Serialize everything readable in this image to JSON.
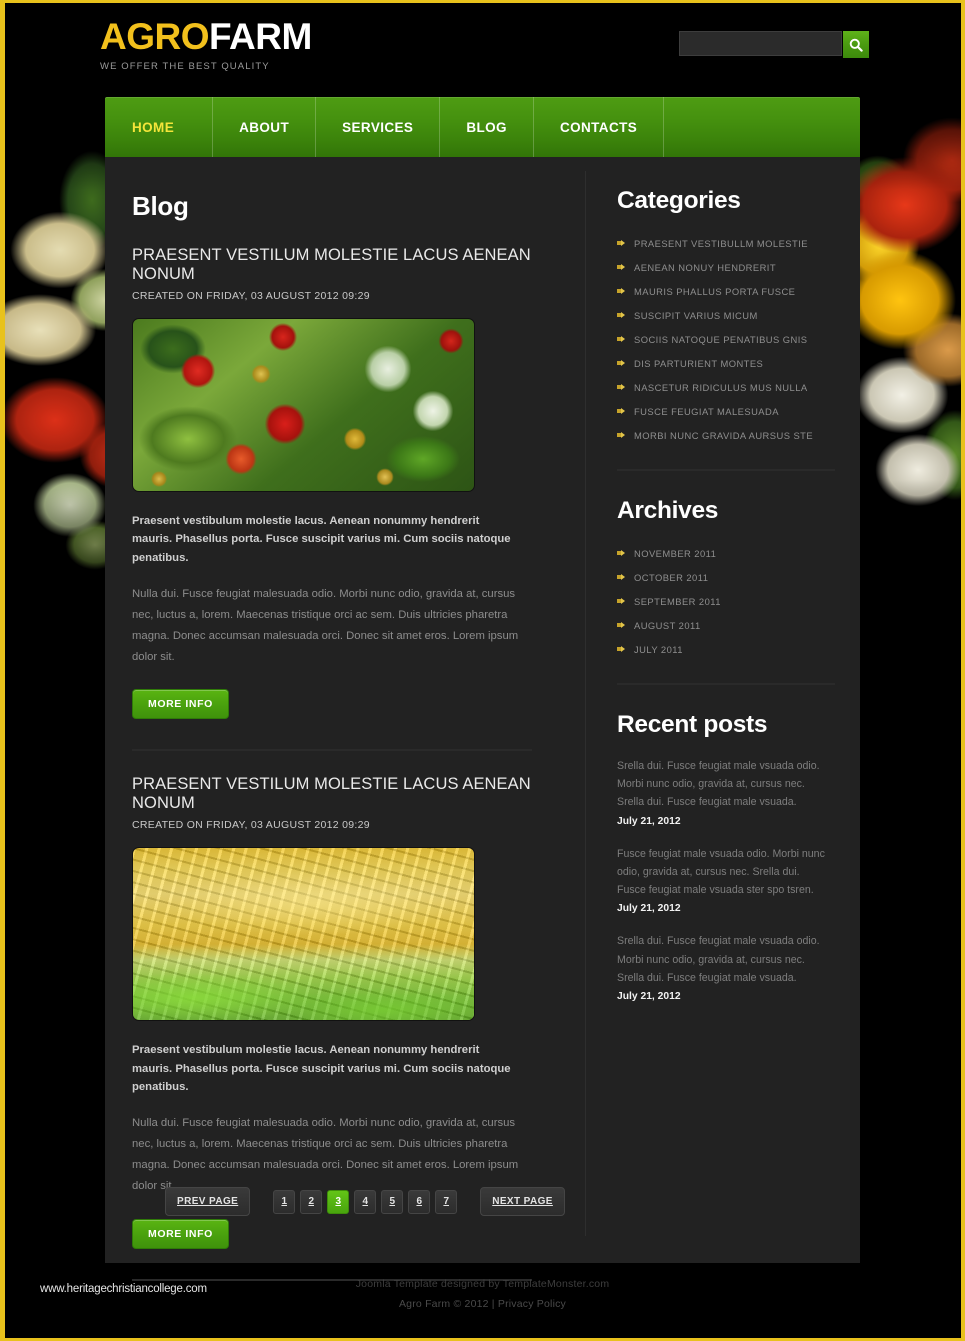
{
  "site": {
    "logo_primary": "AGRO",
    "logo_secondary": "FARM",
    "tagline": "WE OFFER THE BEST QUALITY"
  },
  "search": {
    "value": "",
    "placeholder": "",
    "icon": "search-icon"
  },
  "nav": {
    "items": [
      {
        "label": "HOME",
        "active": true
      },
      {
        "label": "ABOUT",
        "active": false
      },
      {
        "label": "SERVICES",
        "active": false
      },
      {
        "label": "BLOG",
        "active": false
      },
      {
        "label": "CONTACTS",
        "active": false
      }
    ]
  },
  "main": {
    "heading": "Blog",
    "posts": [
      {
        "title": "PRAESENT VESTILUM MOLESTIE LACUS AENEAN NONUM",
        "date": "CREATED ON FRIDAY, 03 AUGUST 2012 09:29",
        "image_alt": "raspberries-photo",
        "lead": "Praesent vestibulum molestie lacus. Aenean nonummy hendrerit mauris. Phasellus porta. Fusce suscipit varius mi. Cum sociis natoque penatibus.",
        "body": "Nulla dui. Fusce feugiat malesuada odio. Morbi nunc odio, gravida at, cursus nec, luctus a, lorem. Maecenas tristique orci ac sem. Duis ultricies pharetra magna. Donec accumsan malesuada orci. Donec sit amet eros. Lorem ipsum dolor sit.",
        "button_label": "MORE INFO"
      },
      {
        "title": "PRAESENT VESTILUM MOLESTIE LACUS AENEAN NONUM",
        "date": "CREATED ON FRIDAY, 03 AUGUST 2012 09:29",
        "image_alt": "corn-photo",
        "lead": "Praesent vestibulum molestie lacus. Aenean nonummy hendrerit mauris. Phasellus porta. Fusce suscipit varius mi. Cum sociis natoque penatibus.",
        "body": "Nulla dui. Fusce feugiat malesuada odio. Morbi nunc odio, gravida at, cursus nec, luctus a, lorem. Maecenas tristique orci ac sem. Duis ultricies pharetra magna. Donec accumsan malesuada orci. Donec sit amet eros. Lorem ipsum dolor sit.",
        "button_label": "MORE INFO"
      }
    ]
  },
  "pagination": {
    "prev_label": "PREV PAGE",
    "next_label": "NEXT PAGE",
    "pages": [
      "1",
      "2",
      "3",
      "4",
      "5",
      "6",
      "7"
    ],
    "current": "3"
  },
  "sidebar": {
    "categories": {
      "title": "Categories",
      "items": [
        "PRAESENT VESTIBULLM MOLESTIE",
        "AENEAN NONUY HENDRERIT",
        "MAURIS PHALLUS PORTA FUSCE",
        "SUSCIPIT VARIUS MICUM",
        "SOCIIS NATOQUE PENATIBUS GNIS",
        "DIS PARTURIENT MONTES",
        "NASCETUR RIDICULUS MUS NULLA",
        "FUSCE FEUGIAT MALESUADA",
        "MORBI NUNC GRAVIDA AURSUS STE"
      ]
    },
    "archives": {
      "title": "Archives",
      "items": [
        "NOVEMBER 2011",
        "OCTOBER 2011",
        "SEPTEMBER 2011",
        "AUGUST 2011",
        "JULY 2011"
      ]
    },
    "recent_posts": {
      "title": "Recent posts",
      "items": [
        {
          "text": "Srella dui. Fusce feugiat male vsuada odio. Morbi nunc odio, gravida at, cursus nec. Srella dui. Fusce feugiat male vsuada.",
          "date": "July 21, 2012"
        },
        {
          "text": "Fusce feugiat male vsuada odio. Morbi nunc odio, gravida at, cursus nec. Srella dui. Fusce feugiat male vsuada ster spo tsren.",
          "date": "July 21, 2012"
        },
        {
          "text": "Srella dui. Fusce feugiat male vsuada odio. Morbi nunc odio, gravida at, cursus nec. Srella dui. Fusce feugiat male vsuada.",
          "date": "July 21, 2012"
        }
      ]
    }
  },
  "footer": {
    "credit": "Joomla Template designed by TemplateMonster.com",
    "copyright": "Agro Farm © 2012  |  ",
    "privacy_label": "Privacy Policy",
    "watermark": "www.heritagechristiancollege.com"
  },
  "colors": {
    "accent_green": "#4ba30e",
    "logo_gold": "#f2c01c",
    "active_nav": "#f4e53a",
    "panel_bg": "#222222",
    "bullet_gold": "#e3c54a"
  }
}
